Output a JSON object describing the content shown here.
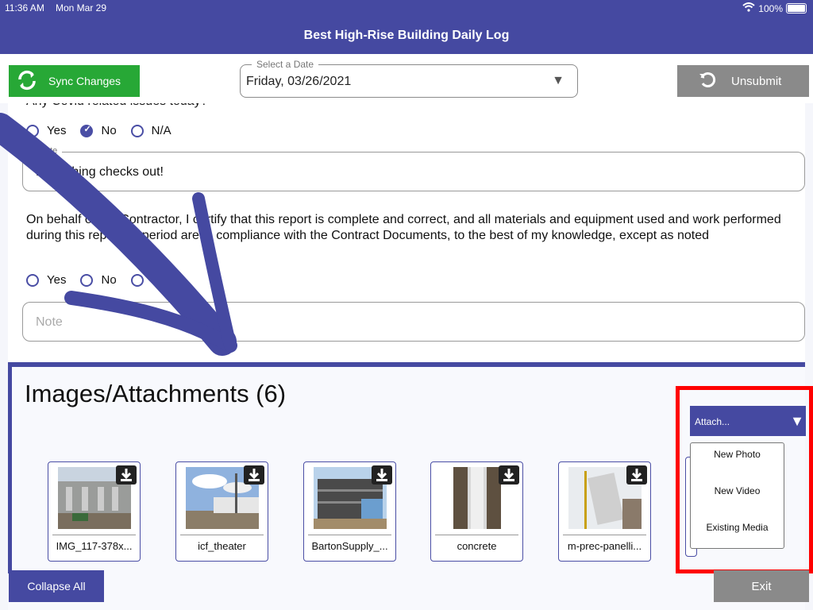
{
  "status_bar": {
    "time": "11:36 AM",
    "date": "Mon Mar 29",
    "battery": "100%"
  },
  "header": {
    "title": "Best High-Rise Building Daily Log"
  },
  "toolbar": {
    "sync_label": "Sync Changes",
    "date_legend": "Select a Date",
    "date_value": "Friday, 03/26/2021",
    "unsubmit_label": "Unsubmit"
  },
  "form": {
    "q1": {
      "text": "Any Covid related issues today?",
      "options": [
        "Yes",
        "No",
        "N/A"
      ],
      "selected": "No"
    },
    "note1": {
      "legend": "Note",
      "value": "Everything checks out!"
    },
    "q2": {
      "text": "On behalf of the Contractor, I certify that this report is complete and correct, and all materials and equipment used and work performed during this reporting period are in compliance with the Contract Documents, to the best of my knowledge, except as noted",
      "options": [
        "Yes",
        "No",
        "N/A"
      ]
    },
    "note2": {
      "placeholder": "Note"
    }
  },
  "attachments": {
    "title": "Images/Attachments (6)",
    "items": [
      {
        "caption": "IMG_117-378x..."
      },
      {
        "caption": "icf_theater"
      },
      {
        "caption": "BartonSupply_..."
      },
      {
        "caption": "concrete"
      },
      {
        "caption": "m-prec-panelli..."
      }
    ],
    "attach_label": "Attach...",
    "menu": [
      "New Photo",
      "New Video",
      "Existing Media"
    ]
  },
  "footer": {
    "collapse_label": "Collapse All",
    "exit_label": "Exit"
  },
  "colors": {
    "primary": "#4549a1",
    "sync_green": "#27a836",
    "grey_button": "#8a8a8a",
    "highlight_red": "#ff0000"
  }
}
